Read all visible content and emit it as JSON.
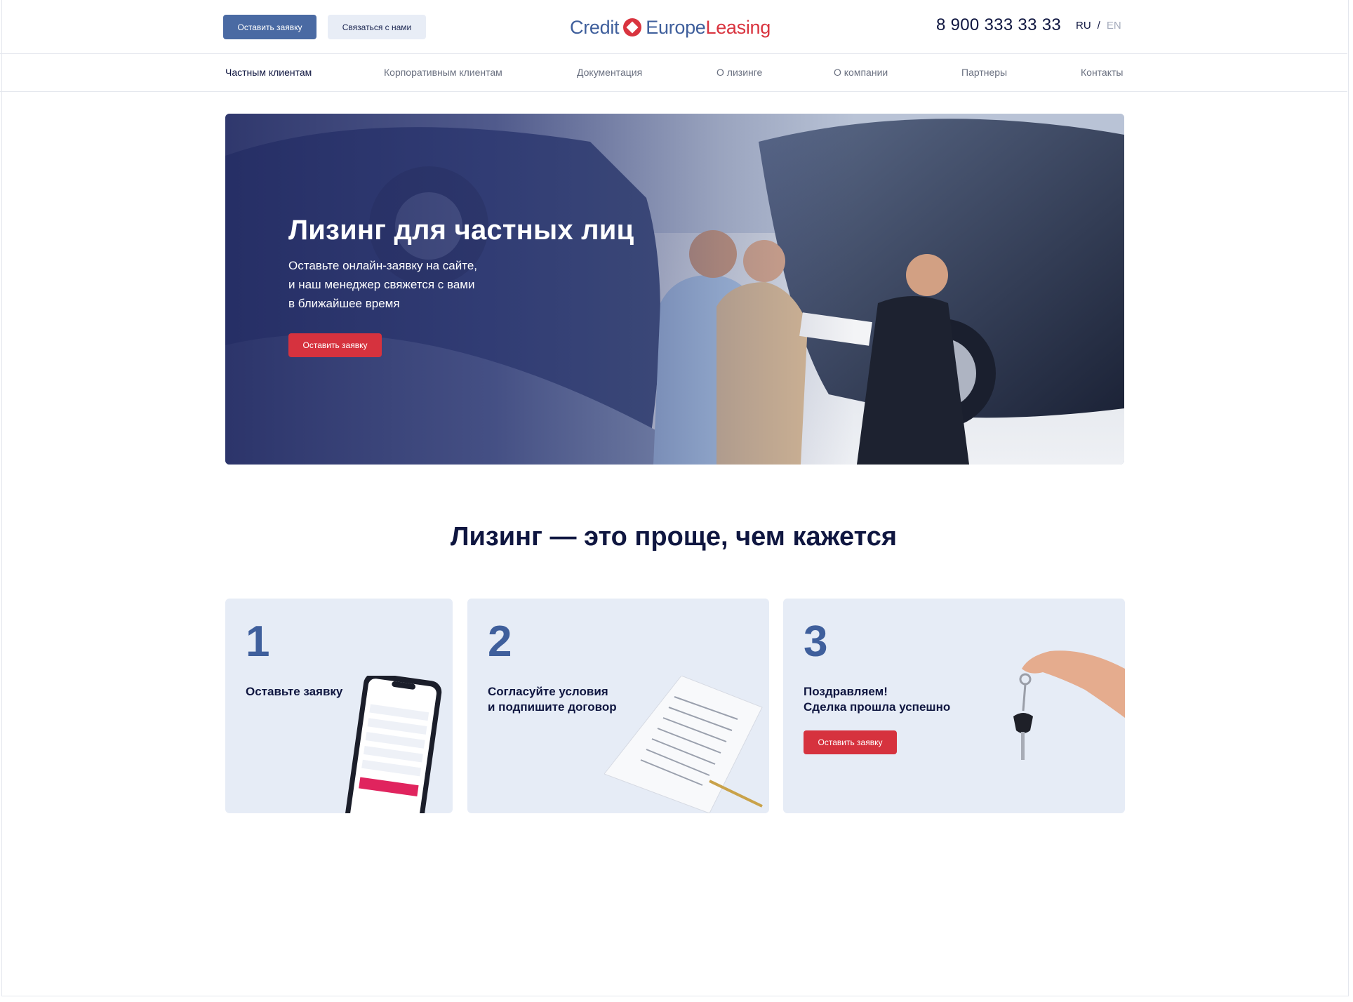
{
  "header": {
    "apply_button": "Оставить заявку",
    "contact_button": "Связаться с нами",
    "logo": {
      "word1": "Credit",
      "word2": "Europe",
      "word3": "Leasing"
    },
    "phone": "8 900 333 33 33",
    "lang": {
      "ru": "RU",
      "sep": "/",
      "en": "EN"
    }
  },
  "nav": {
    "items": [
      {
        "label": "Частным клиентам",
        "active": true
      },
      {
        "label": "Корпоративным клиентам"
      },
      {
        "label": "Документация"
      },
      {
        "label": "О лизинге"
      },
      {
        "label": "О компании"
      },
      {
        "label": "Партнеры"
      },
      {
        "label": "Контакты"
      }
    ]
  },
  "hero": {
    "title": "Лизинг для частных лиц",
    "text_line1": "Оставьте онлайн-заявку на сайте,",
    "text_line2": "и наш менеджер свяжется с вами",
    "text_line3": "в ближайшее время",
    "button": "Оставить заявку"
  },
  "steps": {
    "title": "Лизинг — это проще, чем кажется",
    "items": [
      {
        "num": "1",
        "line1": "Оставьте заявку",
        "line2": ""
      },
      {
        "num": "2",
        "line1": "Согласуйте условия",
        "line2": "и подпишите договор"
      },
      {
        "num": "3",
        "line1": "Поздравляем!",
        "line2": "Сделка прошла успешно",
        "button": "Оставить заявку"
      }
    ]
  },
  "colors": {
    "primary_blue": "#4a6aa3",
    "brand_red": "#d6323e",
    "navy": "#0f1640",
    "card_bg": "#e6ecf6"
  }
}
